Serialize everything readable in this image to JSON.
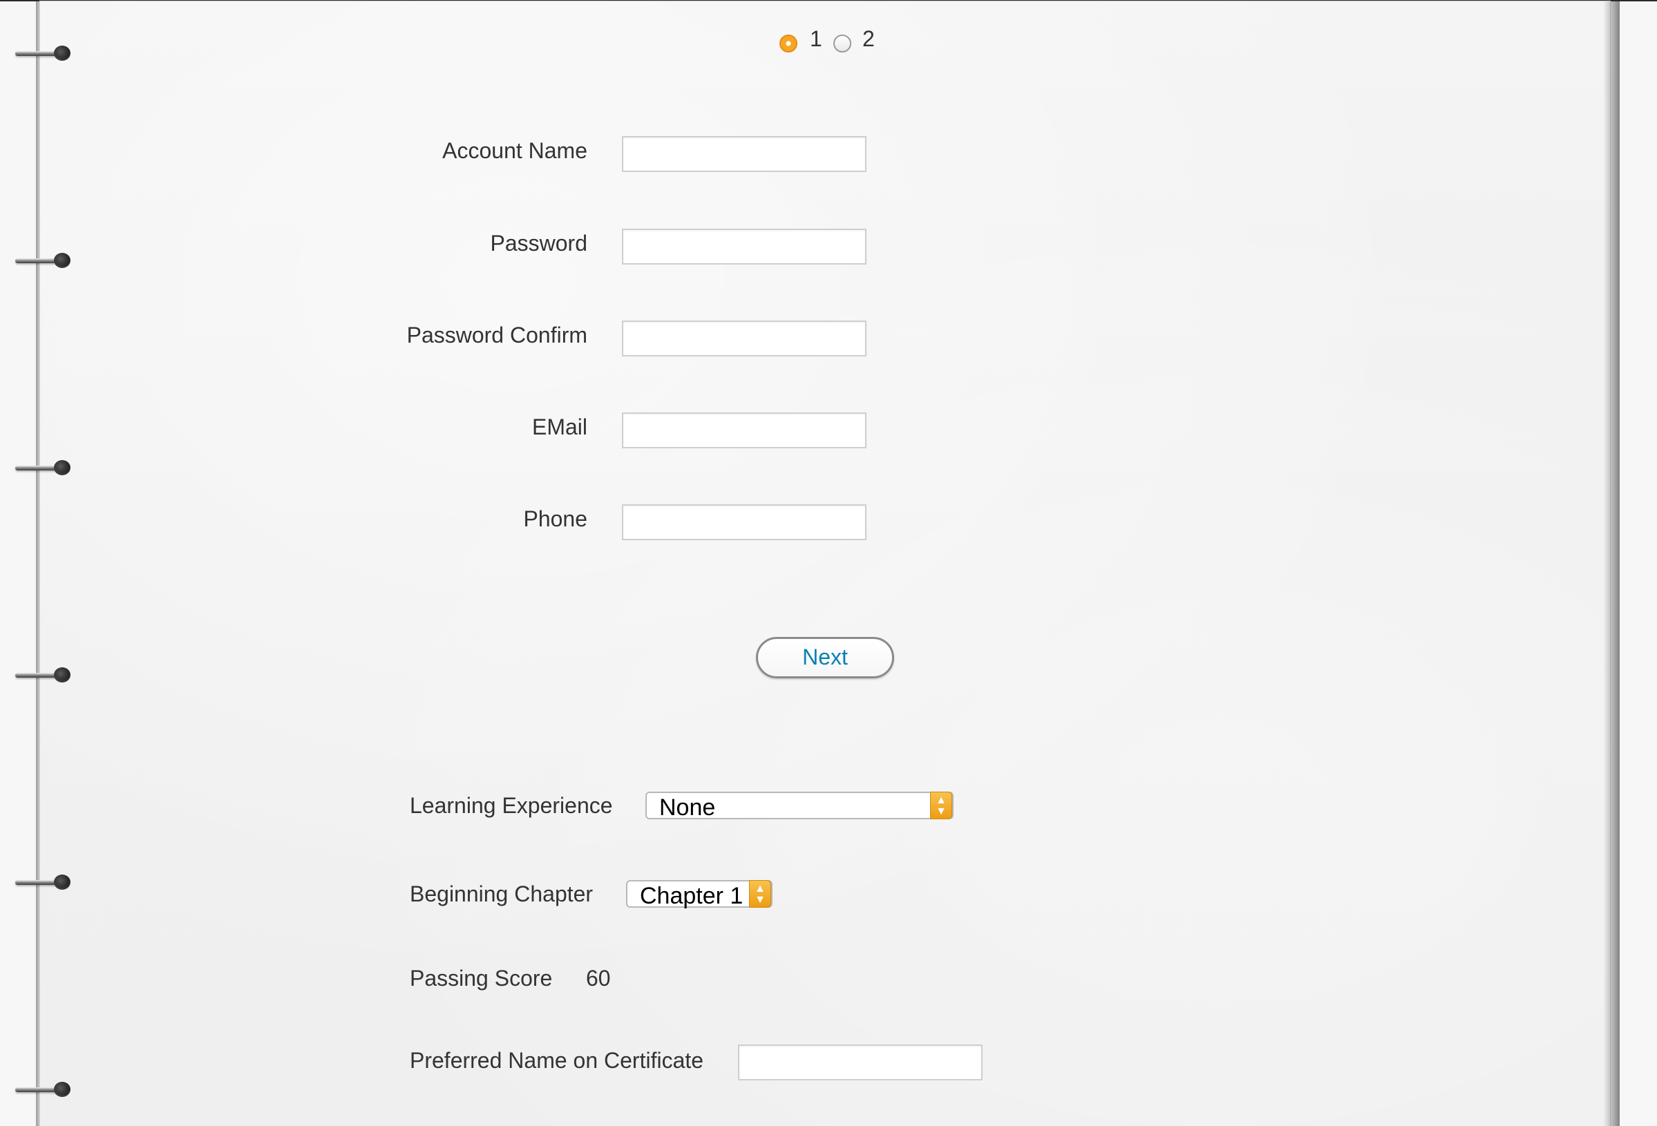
{
  "pager": {
    "step1_label": "1",
    "step2_label": "2",
    "selected_step": "1"
  },
  "account_form": {
    "account_name_label": "Account Name",
    "account_name_value": "",
    "password_label": "Password",
    "password_value": "",
    "password_confirm_label": "Password Confirm",
    "password_confirm_value": "",
    "email_label": "EMail",
    "email_value": "",
    "phone_label": "Phone",
    "phone_value": "",
    "next_label": "Next"
  },
  "course_form": {
    "learning_experience_label": "Learning Experience",
    "learning_experience_value": "None",
    "beginning_chapter_label": "Beginning Chapter",
    "beginning_chapter_value": "Chapter 1",
    "passing_score_label": "Passing Score",
    "passing_score_value": "60",
    "certificate_name_label": "Preferred Name on Certificate",
    "certificate_name_value": ""
  },
  "colors": {
    "accent_orange": "#f6a623",
    "link_blue": "#0a7fb4",
    "paper": "#f0f0f0"
  }
}
